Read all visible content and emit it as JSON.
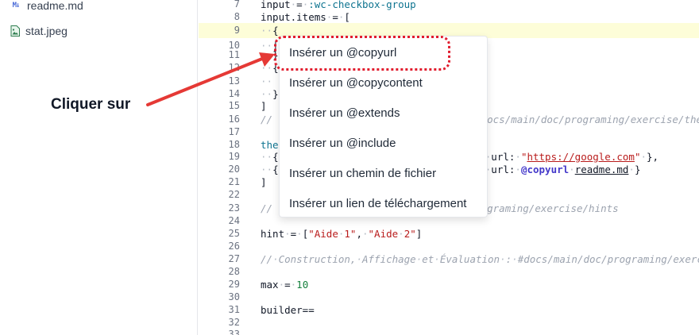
{
  "sidebar": {
    "files": [
      {
        "icon": "markdown-file-icon",
        "icon_text": "M↓",
        "name": "readme.md"
      },
      {
        "icon": "image-file-icon",
        "name": "stat.jpeg"
      }
    ]
  },
  "editor": {
    "active_line": 9,
    "lines": [
      {
        "n": "7",
        "code": "input = :wc-checkbox-group"
      },
      {
        "n": "8",
        "code": "input.items = ["
      },
      {
        "n": "9",
        "code": "  {"
      },
      {
        "n": "10",
        "code": "  |"
      },
      {
        "n": "11",
        "code": "  }"
      },
      {
        "n": "12",
        "code": "  {"
      },
      {
        "n": "13",
        "code": ""
      },
      {
        "n": "14",
        "code": "  }"
      },
      {
        "n": "15",
        "code": "]"
      },
      {
        "n": "16",
        "code": "// #docs/main/doc/programing/exercise/the"
      },
      {
        "n": "17",
        "code": ""
      },
      {
        "n": "18",
        "code": "the"
      },
      {
        "n": "19",
        "code": "  { erne\", url: \"https://google.com\" },"
      },
      {
        "n": "20",
        "code": "  { erne\", url: @copyurl readme.md }"
      },
      {
        "n": "21",
        "code": "]"
      },
      {
        "n": "22",
        "code": ""
      },
      {
        "n": "23",
        "code": "// rograming/exercise/hints"
      },
      {
        "n": "24",
        "code": ""
      },
      {
        "n": "25",
        "code": "hint = [\"Aide 1\", \"Aide 2\"]"
      },
      {
        "n": "26",
        "code": ""
      },
      {
        "n": "27",
        "code": "// Construction, Affichage et Évaluation : #docs/main/doc/programing/exercise"
      },
      {
        "n": "28",
        "code": ""
      },
      {
        "n": "29",
        "code": "max = 10"
      },
      {
        "n": "30",
        "code": ""
      },
      {
        "n": "31",
        "code": "builder=="
      },
      {
        "n": "32",
        "code": ""
      },
      {
        "n": "33",
        "code": ""
      }
    ]
  },
  "menu": {
    "items": [
      "Insérer un @copyurl",
      "Insérer un @copycontent",
      "Insérer un @extends",
      "Insérer un @include",
      "Insérer un chemin de fichier",
      "Insérer un lien de téléchargement"
    ]
  },
  "annotation": {
    "text": "Cliquer sur",
    "highlight_color": "#e11d2e",
    "arrow_color": "#e53935"
  },
  "colors": {
    "active_line_bg": "#fdfdd8",
    "line_number": "#6b7280",
    "comment": "#9ca3af",
    "string": "#b91c1c",
    "macro": "#4338ca",
    "keyword": "#0e7490"
  }
}
